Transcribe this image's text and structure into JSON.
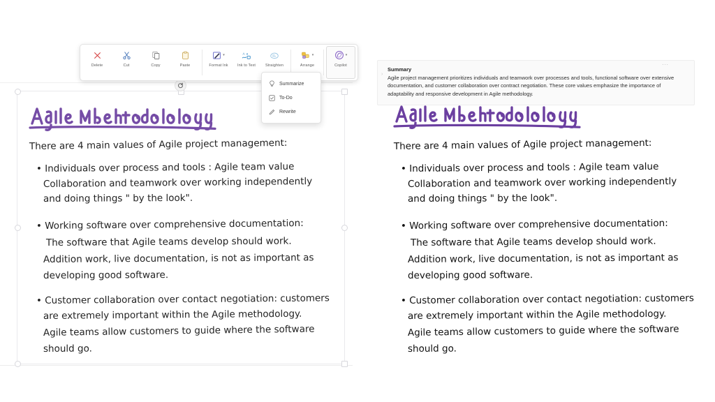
{
  "toolbar": {
    "name": "ink-selection-toolbar",
    "items": [
      {
        "id": "delete",
        "label": "Delete",
        "icon": "delete-x-icon",
        "caret": false
      },
      {
        "id": "cut",
        "label": "Cut",
        "icon": "scissors-icon",
        "caret": false
      },
      {
        "id": "copy",
        "label": "Copy",
        "icon": "copy-icon",
        "caret": false
      },
      {
        "id": "paste",
        "label": "Paste",
        "icon": "clipboard-icon",
        "caret": false
      },
      {
        "id": "format_ink",
        "label": "Format Ink",
        "icon": "format-ink-icon",
        "caret": true
      },
      {
        "id": "ink_to_text",
        "label": "Ink to Text",
        "icon": "ink-to-text-icon",
        "caret": false
      },
      {
        "id": "straighten",
        "label": "Straighten",
        "icon": "straighten-icon",
        "caret": false
      },
      {
        "id": "arrange",
        "label": "Arrange",
        "icon": "arrange-icon",
        "caret": true
      },
      {
        "id": "copilot",
        "label": "Copilot",
        "icon": "copilot-icon",
        "caret": true
      }
    ]
  },
  "copilot_menu": {
    "open": true,
    "items": [
      {
        "id": "summarize",
        "label": "Summarize",
        "icon": "lightbulb-icon"
      },
      {
        "id": "todo",
        "label": "To-Do",
        "icon": "checkbox-icon"
      },
      {
        "id": "rewrite",
        "label": "Rewrite",
        "icon": "pencil-icon"
      }
    ]
  },
  "summary_card": {
    "title": "Summary",
    "body": "Agile project management prioritizes individuals and teamwork over processes and tools, functional software over extensive documentation, and customer collaboration over contract negotiation. These core values emphasize the importance of adaptability and responsive development in Agile methodology.",
    "more_label": "···",
    "bullet_glyph": "›"
  },
  "note": {
    "title": "Agile Methodology",
    "intro": "There are 4 main values of Agile project management:",
    "bullets": [
      {
        "lines": [
          "Individuals over process and tools : Agile team value",
          "Collaboration and teamwork over working independently",
          "and doing things \" by the look\"."
        ]
      },
      {
        "lines": [
          "Working software over comprehensive documentation:",
          "The software that Agile teams develop should work.",
          "Addition work, live documentation, is not as important as",
          "developing good software."
        ]
      },
      {
        "lines": [
          "Customer collaboration over contact negotiation: customers",
          "are extremely important within the Agile methodology.",
          "Agile teams allow customers to guide where the software",
          "should go."
        ]
      }
    ]
  },
  "selection": {
    "label": "ink-selection",
    "rotate_handle_label": "rotate-handle"
  },
  "colors": {
    "ink_purple": "#6b3fa0",
    "ink_black": "#111111",
    "accent_copilot": "#8661c5",
    "toolbar_border": "#e3e3e3",
    "card_bg": "#fafafa",
    "text_body": "#2f2f2f"
  }
}
